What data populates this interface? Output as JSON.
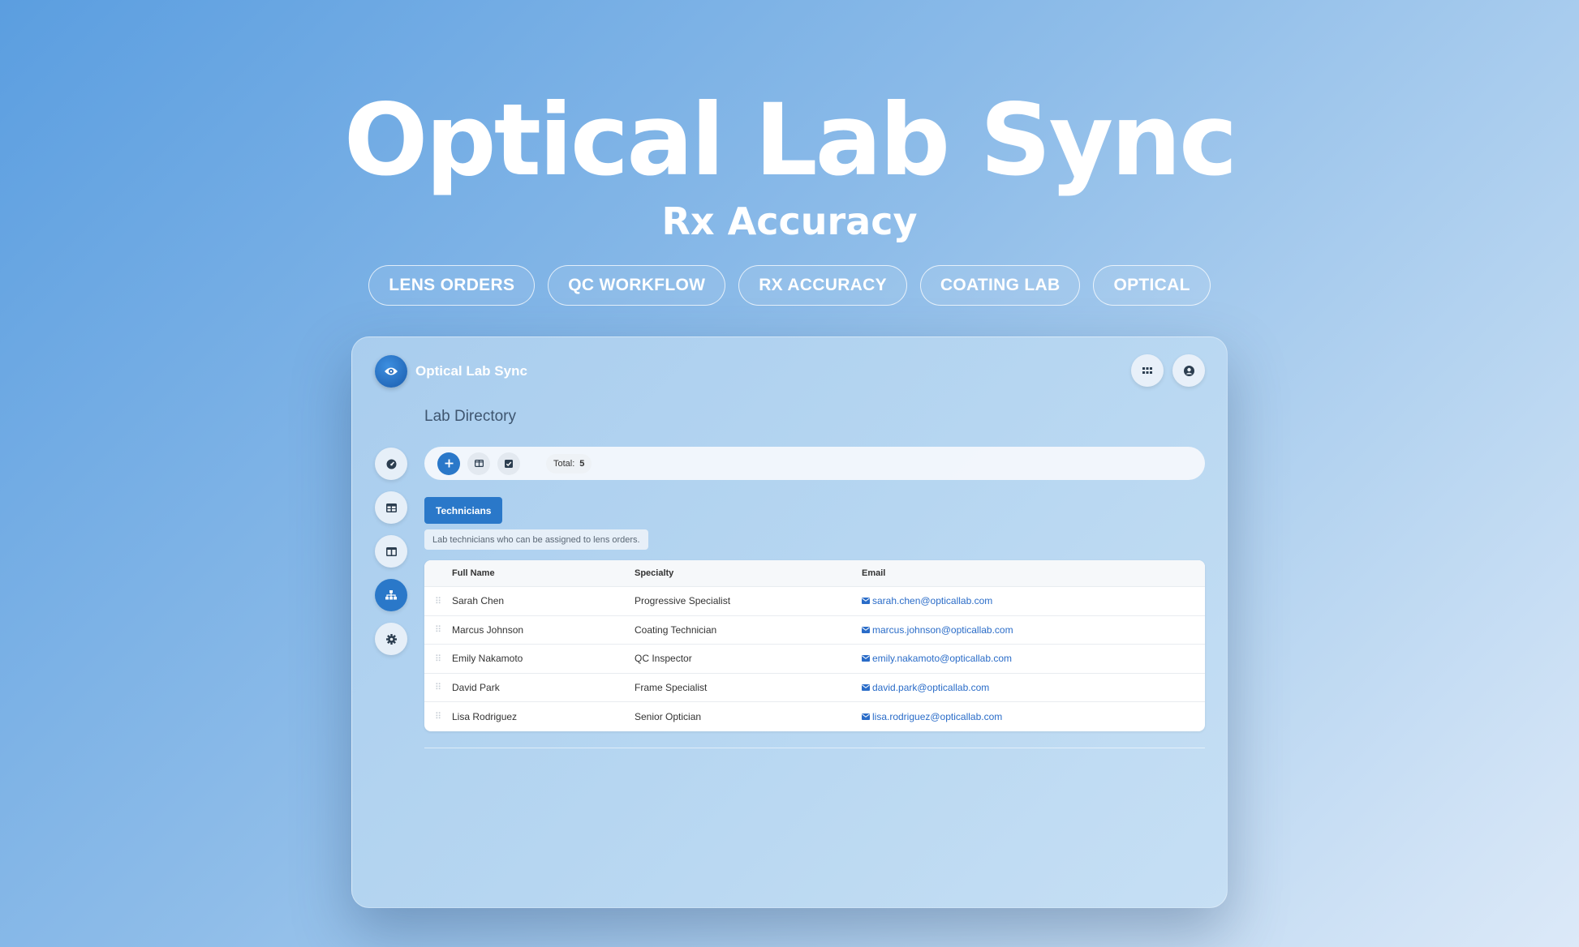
{
  "hero": {
    "title": "Optical Lab Sync",
    "subtitle": "Rx Accuracy",
    "tags": [
      "LENS ORDERS",
      "QC WORKFLOW",
      "RX ACCURACY",
      "COATING LAB",
      "OPTICAL"
    ]
  },
  "app": {
    "name": "Optical Lab Sync",
    "logo_icon": "eye-icon",
    "top_actions": [
      "apps-grid-icon",
      "user-circle-icon"
    ]
  },
  "page": {
    "title": "Lab Directory"
  },
  "sidebar": {
    "items": [
      {
        "icon": "dashboard-icon",
        "active": false
      },
      {
        "icon": "table-icon",
        "active": false
      },
      {
        "icon": "columns-icon",
        "active": false
      },
      {
        "icon": "hierarchy-icon",
        "active": true
      },
      {
        "icon": "gear-icon",
        "active": false
      }
    ]
  },
  "toolbar": {
    "buttons": [
      "plus-icon",
      "columns-icon",
      "checkbox-icon"
    ],
    "total_label": "Total:",
    "total_value": "5"
  },
  "tab": {
    "label": "Technicians"
  },
  "description": "Lab technicians who can be assigned to lens orders.",
  "table": {
    "columns": [
      "Full Name",
      "Specialty",
      "Email"
    ],
    "rows": [
      {
        "name": "Sarah Chen",
        "specialty": "Progressive Specialist",
        "email": "sarah.chen@opticallab.com"
      },
      {
        "name": "Marcus Johnson",
        "specialty": "Coating Technician",
        "email": "marcus.johnson@opticallab.com"
      },
      {
        "name": "Emily Nakamoto",
        "specialty": "QC Inspector",
        "email": "emily.nakamoto@opticallab.com"
      },
      {
        "name": "David Park",
        "specialty": "Frame Specialist",
        "email": "david.park@opticallab.com"
      },
      {
        "name": "Lisa Rodriguez",
        "specialty": "Senior Optician",
        "email": "lisa.rodriguez@opticallab.com"
      }
    ]
  },
  "colors": {
    "accent": "#2a78c9",
    "link": "#2a6cc8"
  }
}
